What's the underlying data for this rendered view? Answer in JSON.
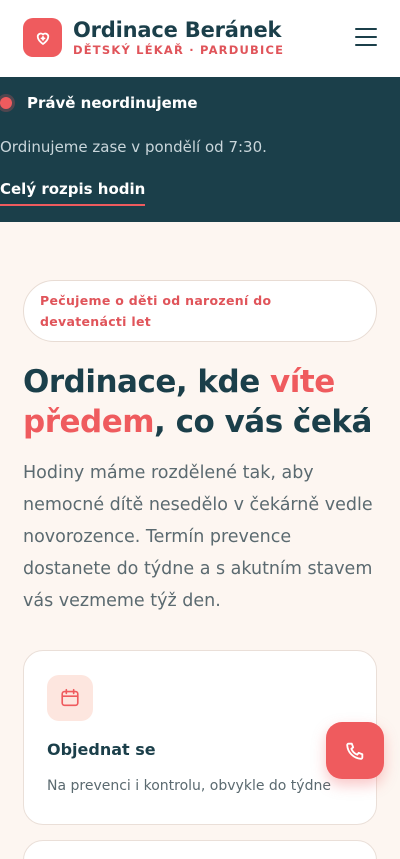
{
  "header": {
    "brand_title": "Ordinace Beránek",
    "brand_subtitle": "DĚTSKÝ LÉKAŘ · PARDUBICE",
    "logo_icon": "heart-icon",
    "menu_icon": "hamburger-menu-icon"
  },
  "status": {
    "title": "Právě neordinujeme",
    "text": "Ordinujeme zase v pondělí od 7:30.",
    "link": "Celý rozpis hodin"
  },
  "hero": {
    "pill": "Pečujeme o děti od narození do devatenácti let",
    "headline_part1": "Ordinace, kde ",
    "headline_accent": "víte předem",
    "headline_part2": ", co vás čeká",
    "intro": "Hodiny máme rozdělené tak, aby nemocné dítě nesedělo v čekárně vedle novorozence. Termín prevence dostanete do týdne a s akutním stavem vás vezmeme týž den."
  },
  "cards": [
    {
      "icon": "calendar-icon",
      "title": "Objednat se",
      "description": "Na prevenci i kontrolu, obvykle do týdne"
    }
  ],
  "fab": {
    "icon": "phone-icon"
  },
  "colors": {
    "accent": "#ef5b5e",
    "dark": "#1b3f4a",
    "background": "#fdf6f1"
  }
}
